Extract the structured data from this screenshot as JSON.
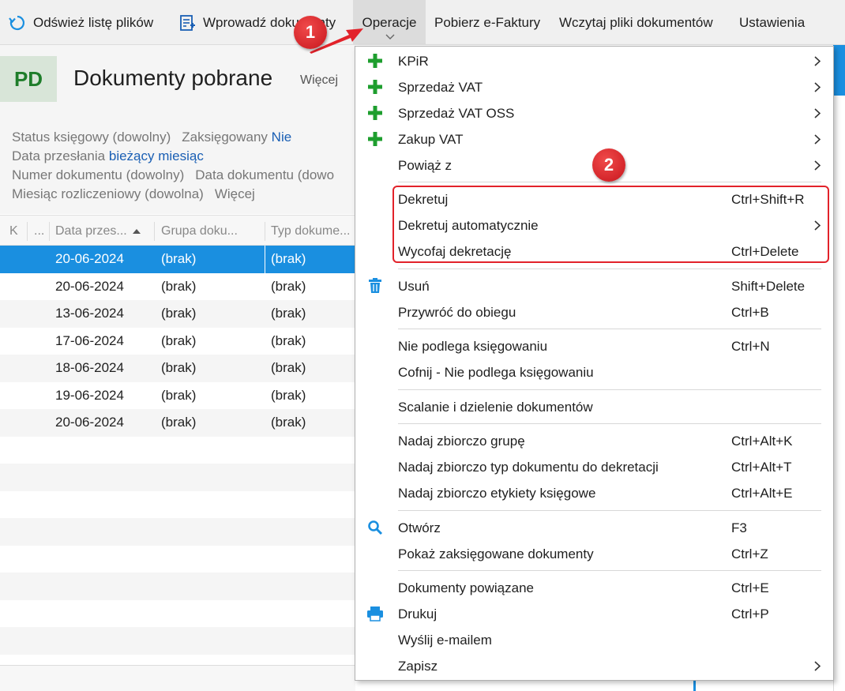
{
  "toolbar": {
    "refresh": "Odśwież listę plików",
    "enter": "Wprowadź dokumenty",
    "operations": "Operacje",
    "efaktury": "Pobierz e-Faktury",
    "load_files": "Wczytaj pliki dokumentów",
    "settings": "Ustawienia"
  },
  "header": {
    "badge": "PD",
    "title": "Dokumenty pobrane",
    "more": "Więcej"
  },
  "filters": {
    "status_label": "Status księgowy (dowolny)",
    "posted_label": "Zaksięgowany",
    "posted_value": "Nie",
    "sent_date_label": "Data przesłania",
    "sent_date_value": "bieżący miesiąc",
    "doc_number_label": "Numer dokumentu (dowolny)",
    "doc_date_label": "Data dokumentu (dowo",
    "settlement_month_label": "Miesiąc rozliczeniowy (dowolna)",
    "more": "Więcej"
  },
  "grid": {
    "headers": [
      "K",
      "...",
      "Data przes...",
      "Grupa doku...",
      "Typ dokume..."
    ],
    "rows": [
      {
        "date": "20-06-2024",
        "group": "(brak)",
        "type": "(brak)"
      },
      {
        "date": "20-06-2024",
        "group": "(brak)",
        "type": "(brak)"
      },
      {
        "date": "13-06-2024",
        "group": "(brak)",
        "type": "(brak)"
      },
      {
        "date": "17-06-2024",
        "group": "(brak)",
        "type": "(brak)"
      },
      {
        "date": "18-06-2024",
        "group": "(brak)",
        "type": "(brak)"
      },
      {
        "date": "19-06-2024",
        "group": "(brak)",
        "type": "(brak)"
      },
      {
        "date": "20-06-2024",
        "group": "(brak)",
        "type": "(brak)"
      }
    ]
  },
  "menu": {
    "items": [
      {
        "label": "KPiR",
        "shortcut": "",
        "icon": "plus-icon",
        "submenu": true
      },
      {
        "label": "Sprzedaż VAT",
        "shortcut": "",
        "icon": "plus-icon",
        "submenu": true
      },
      {
        "label": "Sprzedaż VAT OSS",
        "shortcut": "",
        "icon": "plus-icon",
        "submenu": true
      },
      {
        "label": "Zakup VAT",
        "shortcut": "",
        "icon": "plus-icon",
        "submenu": true
      },
      {
        "label": "Powiąż z",
        "shortcut": "",
        "icon": "",
        "submenu": true
      },
      {
        "label": "Dekretuj",
        "shortcut": "Ctrl+Shift+R",
        "icon": "",
        "submenu": false
      },
      {
        "label": "Dekretuj automatycznie",
        "shortcut": "",
        "icon": "",
        "submenu": true
      },
      {
        "label": "Wycofaj dekretację",
        "shortcut": "Ctrl+Delete",
        "icon": "",
        "submenu": false
      },
      {
        "label": "Usuń",
        "shortcut": "Shift+Delete",
        "icon": "trash-icon",
        "submenu": false
      },
      {
        "label": "Przywróć do obiegu",
        "shortcut": "Ctrl+B",
        "icon": "",
        "submenu": false
      },
      {
        "label": "Nie podlega księgowaniu",
        "shortcut": "Ctrl+N",
        "icon": "",
        "submenu": false
      },
      {
        "label": "Cofnij - Nie podlega księgowaniu",
        "shortcut": "",
        "icon": "",
        "submenu": false
      },
      {
        "label": "Scalanie i dzielenie dokumentów",
        "shortcut": "",
        "icon": "",
        "submenu": false
      },
      {
        "label": "Nadaj zbiorczo grupę",
        "shortcut": "Ctrl+Alt+K",
        "icon": "",
        "submenu": false
      },
      {
        "label": "Nadaj zbiorczo typ dokumentu do dekretacji",
        "shortcut": "Ctrl+Alt+T",
        "icon": "",
        "submenu": false
      },
      {
        "label": "Nadaj zbiorczo etykiety księgowe",
        "shortcut": "Ctrl+Alt+E",
        "icon": "",
        "submenu": false
      },
      {
        "label": "Otwórz",
        "shortcut": "F3",
        "icon": "search-icon",
        "submenu": false
      },
      {
        "label": "Pokaż zaksięgowane dokumenty",
        "shortcut": "Ctrl+Z",
        "icon": "",
        "submenu": false
      },
      {
        "label": "Dokumenty powiązane",
        "shortcut": "Ctrl+E",
        "icon": "",
        "submenu": false
      },
      {
        "label": "Drukuj",
        "shortcut": "Ctrl+P",
        "icon": "printer-icon",
        "submenu": false
      },
      {
        "label": "Wyślij e-mailem",
        "shortcut": "",
        "icon": "",
        "submenu": false
      },
      {
        "label": "Zapisz",
        "shortcut": "",
        "icon": "",
        "submenu": true
      }
    ]
  },
  "annotations": {
    "badge1": "1",
    "badge2": "2"
  },
  "colors": {
    "accent": "#1a8fe0",
    "plus_green": "#1e9e2e",
    "annotation_red": "#e2222a"
  }
}
